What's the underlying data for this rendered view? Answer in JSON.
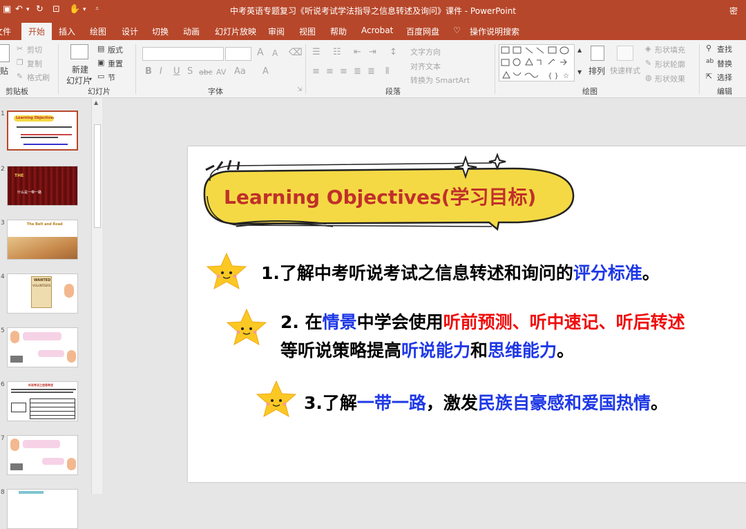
{
  "titlebar": {
    "title": "中考英语专题复习《听说考试学法指导之信息转述及询问》课件  -  PowerPoint",
    "right_label": "密"
  },
  "tabs": [
    "文件",
    "开始",
    "插入",
    "绘图",
    "设计",
    "切换",
    "动画",
    "幻灯片放映",
    "审阅",
    "视图",
    "帮助",
    "Acrobat",
    "百度网盘",
    "操作说明搜索"
  ],
  "ribbon": {
    "clipboard": {
      "paste": "贴",
      "cut": "剪切",
      "copy": "复制",
      "format_painter": "格式刷",
      "label": "剪贴板"
    },
    "slides": {
      "new_slide": "新建",
      "new_slide2": "幻灯片",
      "layout": "版式",
      "reset": "重置",
      "section": "节",
      "label": "幻灯片"
    },
    "font": {
      "label": "字体",
      "bold": "B",
      "italic": "I",
      "underline": "U",
      "shadow": "S",
      "strike": "abc",
      "spacing": "AV",
      "case": "Aa",
      "grow": "A",
      "shrink": "A"
    },
    "paragraph": {
      "text_direction": "文字方向",
      "align_text": "对齐文本",
      "smartart": "转换为 SmartArt",
      "label": "段落"
    },
    "drawing": {
      "arrange": "排列",
      "quick_styles": "快速样式",
      "shape_fill": "形状填充",
      "shape_outline": "形状轮廓",
      "shape_effects": "形状效果",
      "label": "绘图"
    },
    "editing": {
      "find": "查找",
      "replace": "替换",
      "select": "选择",
      "label": "编辑"
    }
  },
  "thumbnails": [
    "1",
    "2",
    "3",
    "4",
    "5",
    "6",
    "7",
    "8"
  ],
  "thumb_texts": {
    "t1": "Learning Objectives(学习目标)",
    "t2_word": "THE",
    "t2_text": "什么是一带一路",
    "t3_title": "The Belt and Road",
    "t4_title": "WANTED",
    "t4_sub": "VOLUNTEERS",
    "t6_title": "听说考试之信息转述"
  },
  "slide": {
    "title": "Learning Objectives(学习目标)",
    "item1": {
      "a": "1.了解中考听说考试之信息转述和询问的",
      "b": "评分标准",
      "c": "。"
    },
    "item2": {
      "a": "2. 在",
      "b": "情景",
      "c": "中学会使用",
      "d": "听前预测、听中速记、听后转述",
      "e": "等听说策略提高",
      "f": "听说能力",
      "g": "和",
      "h": "思维能力",
      "i": "。"
    },
    "item3": {
      "a": "3.了解",
      "b": "一带一路",
      "c": "，激发",
      "d": "民族自豪感和爱国热情",
      "e": "。"
    }
  },
  "colors": {
    "accent": "#b7472a",
    "blue_text": "#1f38e6",
    "red_text": "#f00c0c",
    "banner": "#f4d944",
    "star": "#fcc823"
  }
}
